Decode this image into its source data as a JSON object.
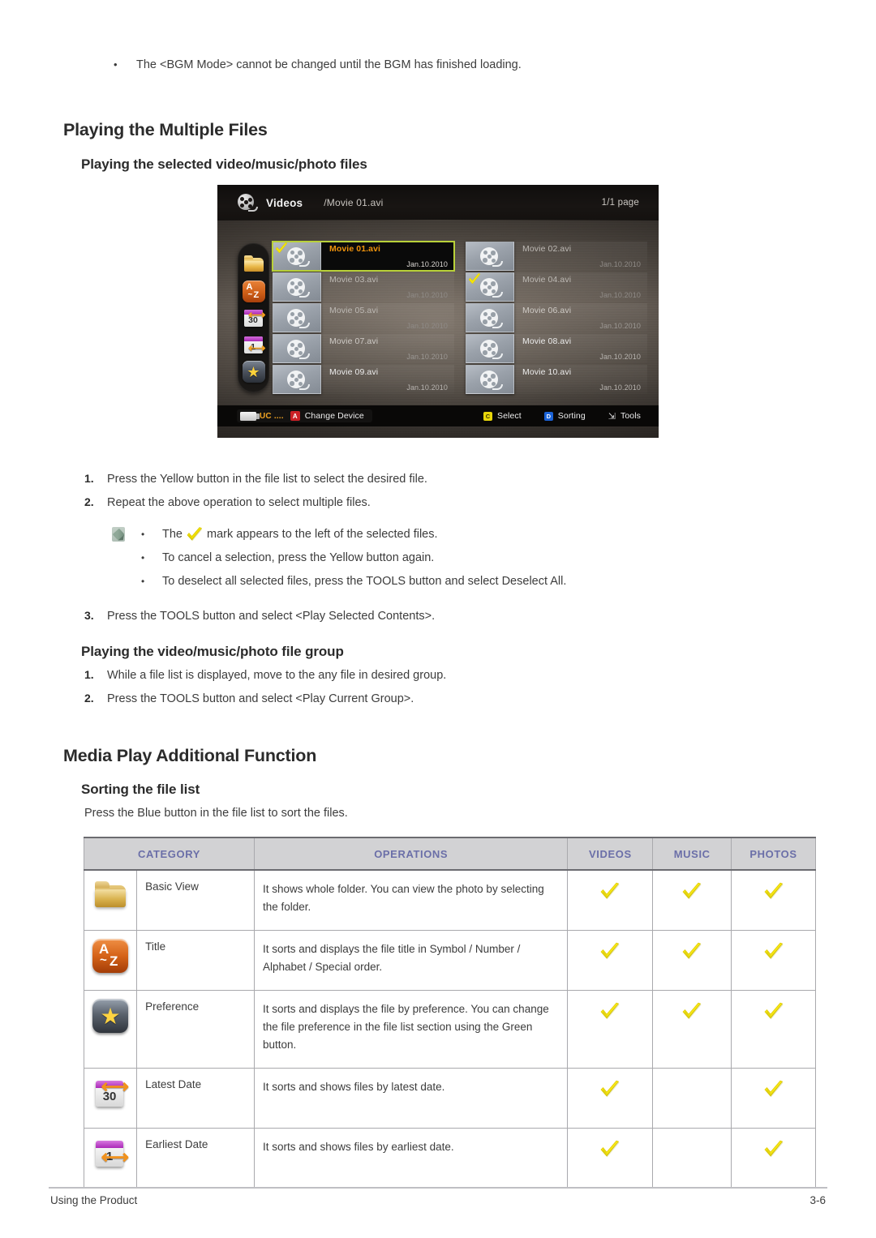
{
  "top_note": {
    "bullet": "•",
    "text": "The <BGM Mode> cannot be changed until the BGM has finished loading."
  },
  "headings": {
    "h1_multiple_files": "Playing the Multiple Files",
    "h2_selected_files": "Playing the selected video/music/photo files",
    "h2_file_group": "Playing the video/music/photo file group",
    "h1_additional_function": "Media Play Additional Function",
    "h2_sorting": "Sorting the file list"
  },
  "tv_screen": {
    "icon": "film-reel-icon",
    "title": "Videos",
    "path": "/Movie 01.avi",
    "page_indicator": "1/1 page",
    "sidebar_icons": [
      {
        "name": "folder-icon",
        "label": "Basic View"
      },
      {
        "name": "a-to-z-icon",
        "label": "Title"
      },
      {
        "name": "calendar-30-icon",
        "label": "Latest Date"
      },
      {
        "name": "calendar-1-icon",
        "label": "Earliest Date"
      },
      {
        "name": "star-icon",
        "label": "Preference"
      }
    ],
    "files": [
      {
        "name": "Movie 01.avi",
        "date": "Jan.10.2010",
        "checked": true,
        "highlighted": true,
        "col": 0,
        "row": 0,
        "dim": 0
      },
      {
        "name": "Movie 02.avi",
        "date": "Jan.10.2010",
        "checked": false,
        "highlighted": false,
        "col": 1,
        "row": 0,
        "dim": 2
      },
      {
        "name": "Movie 03.avi",
        "date": "Jan.10.2010",
        "checked": false,
        "highlighted": false,
        "col": 0,
        "row": 1,
        "dim": 2
      },
      {
        "name": "Movie 04.avi",
        "date": "Jan.10.2010",
        "checked": true,
        "highlighted": false,
        "col": 1,
        "row": 1,
        "dim": 2
      },
      {
        "name": "Movie 05.avi",
        "date": "Jan.10.2010",
        "checked": false,
        "highlighted": false,
        "col": 0,
        "row": 2,
        "dim": 2
      },
      {
        "name": "Movie 06.avi",
        "date": "Jan.10.2010",
        "checked": false,
        "highlighted": false,
        "col": 1,
        "row": 2,
        "dim": 1
      },
      {
        "name": "Movie 07.avi",
        "date": "Jan.10.2010",
        "checked": false,
        "highlighted": false,
        "col": 0,
        "row": 3,
        "dim": 1
      },
      {
        "name": "Movie 08.avi",
        "date": "Jan.10.2010",
        "checked": false,
        "highlighted": false,
        "col": 1,
        "row": 3,
        "dim": 0
      },
      {
        "name": "Movie 09.avi",
        "date": "Jan.10.2010",
        "checked": false,
        "highlighted": false,
        "col": 0,
        "row": 4,
        "dim": 0
      },
      {
        "name": "Movie 10.avi",
        "date": "Jan.10.2010",
        "checked": false,
        "highlighted": false,
        "col": 1,
        "row": 4,
        "dim": 0
      }
    ],
    "bottom_bar": {
      "device_label": "UC ....",
      "key_a": "A",
      "change_device": "Change Device",
      "key_c": "C",
      "select": "Select",
      "key_d": "D",
      "sorting": "Sorting",
      "tools_icon": "tools-icon",
      "tools": "Tools"
    }
  },
  "steps_selected": [
    {
      "num": "1.",
      "text": "Press the Yellow button in the file list to select the desired file."
    },
    {
      "num": "2.",
      "text": "Repeat the above operation to select multiple files."
    }
  ],
  "note_bullets": {
    "icon": "note-pencil-icon",
    "bullet": "•",
    "items": [
      {
        "pre": "The",
        "has_check": true,
        "post": "mark appears to the left of the selected files."
      },
      {
        "pre": "To cancel a selection, press the Yellow button again.",
        "has_check": false,
        "post": ""
      },
      {
        "pre": "To deselect all selected files, press the TOOLS button and select Deselect All.",
        "has_check": false,
        "post": ""
      }
    ]
  },
  "step3": {
    "num": "3.",
    "text": "Press the TOOLS button and select <Play Selected Contents>."
  },
  "steps_group": [
    {
      "num": "1.",
      "text": "While a file list is displayed, move to the any file in desired group."
    },
    {
      "num": "2.",
      "text": "Press the TOOLS button and select <Play Current Group>."
    }
  ],
  "sorting_intro": "Press the Blue button in the file list to sort the files.",
  "sort_table": {
    "headers": [
      "CATEGORY",
      "OPERATIONS",
      "VIDEOS",
      "MUSIC",
      "PHOTOS"
    ],
    "header_color": "#6b6fa8",
    "header_bg": "#d2d2d4",
    "rows": [
      {
        "icon": "folder-icon",
        "category": "Basic View",
        "operations": "It shows whole folder. You can view the photo by selecting the folder.",
        "videos": true,
        "music": true,
        "photos": true
      },
      {
        "icon": "a-to-z-icon",
        "category": "Title",
        "operations": "It sorts and displays the file title in Symbol / Number / Alphabet / Special order.",
        "videos": true,
        "music": true,
        "photos": true
      },
      {
        "icon": "star-icon",
        "category": "Preference",
        "operations": "It sorts and displays the file by preference. You can change the file preference in the file list section using the Green button.",
        "videos": true,
        "music": true,
        "photos": true
      },
      {
        "icon": "calendar-30-icon",
        "category": "Latest Date",
        "operations": "It sorts and shows files by latest date.",
        "videos": true,
        "music": false,
        "photos": true
      },
      {
        "icon": "calendar-1-icon",
        "category": "Earliest Date",
        "operations": "It sorts and shows files by earliest date.",
        "videos": true,
        "music": false,
        "photos": true
      }
    ]
  },
  "footer": {
    "left": "Using the Product",
    "right": "3-6"
  }
}
